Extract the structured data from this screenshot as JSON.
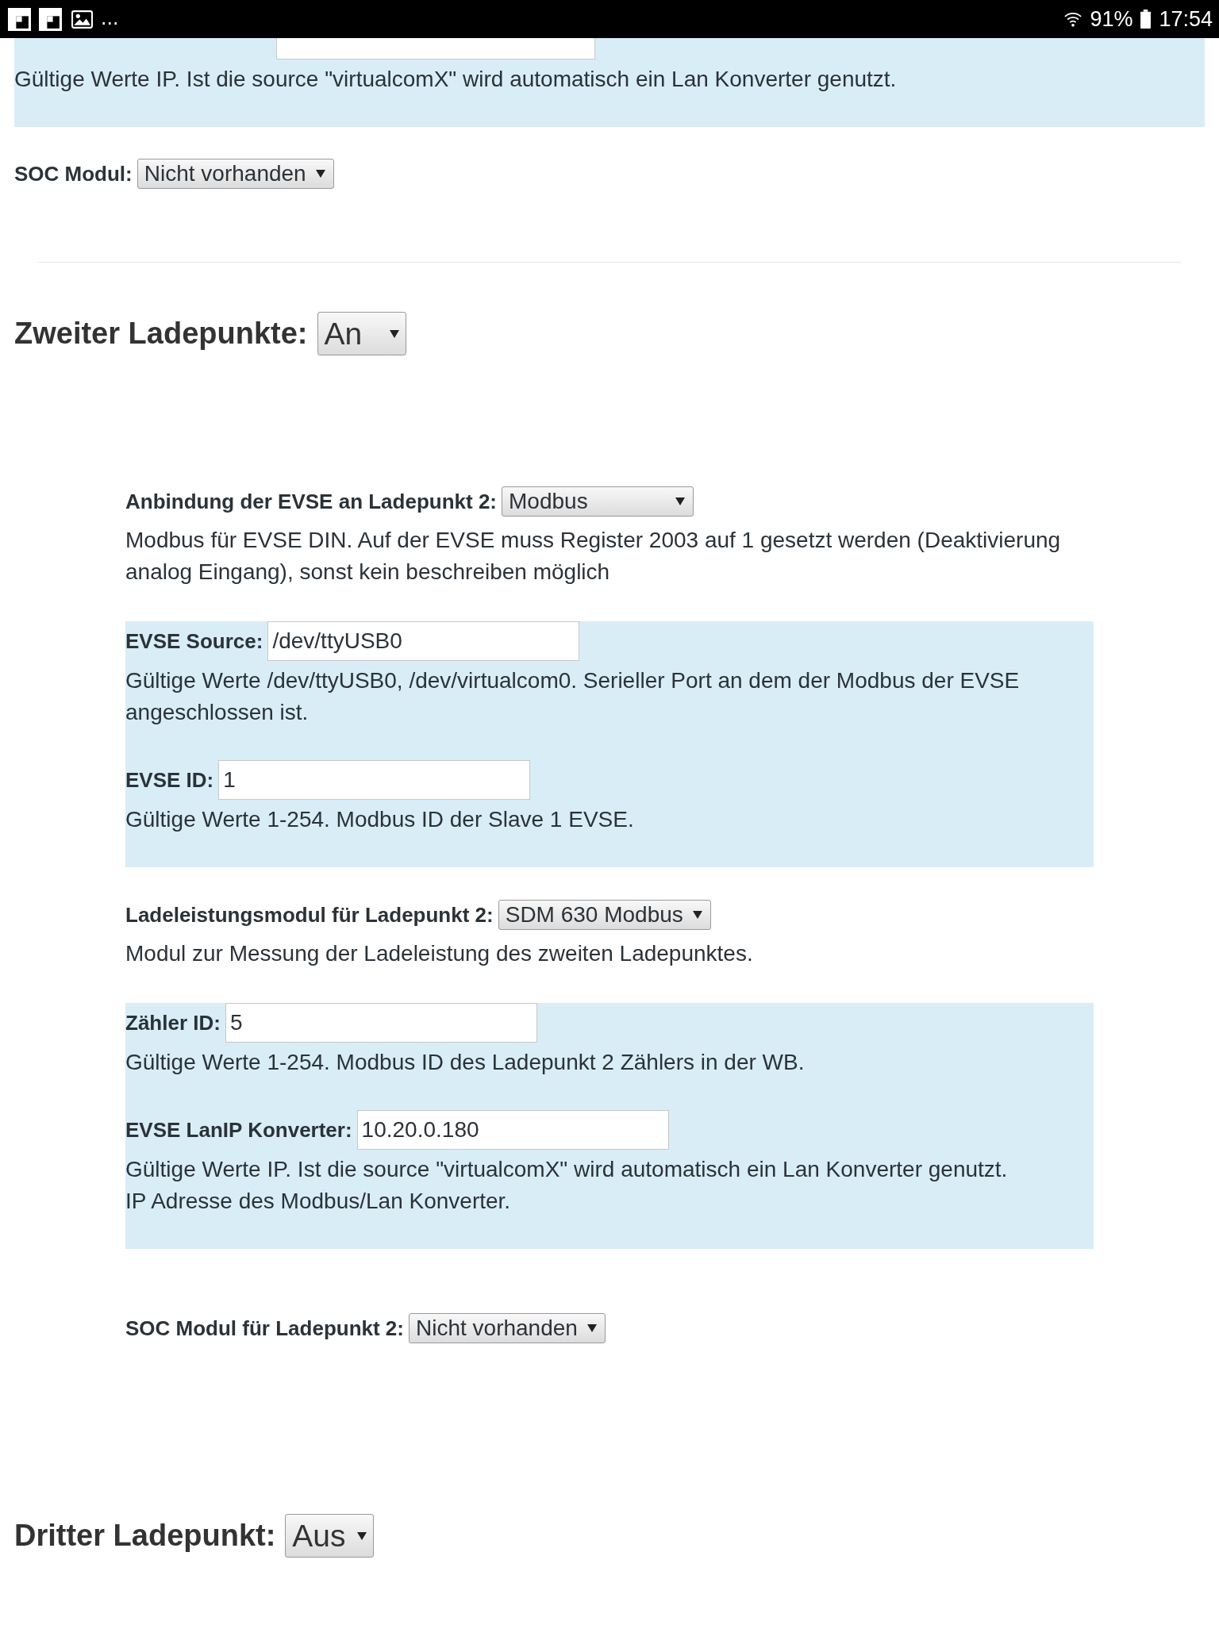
{
  "status_bar": {
    "more": "...",
    "battery": "91%",
    "time": "17:54"
  },
  "settings": [
    {
      "kind": "panel",
      "fields": [
        {
          "kind": "cut_off",
          "help": [
            "Gültige Werte IP. Ist die source \"virtualcomX\" wird automatisch ein Lan Konverter genutzt."
          ]
        }
      ]
    },
    {
      "kind": "select",
      "label": "SOC Modul:",
      "value": "Nicht vorhanden"
    },
    {
      "kind": "divider"
    },
    {
      "kind": "heading",
      "label": "Zweiter Ladepunkte:",
      "value": "An",
      "details": [
        {
          "kind": "select",
          "label": "Anbindung der EVSE an Ladepunkt 2:",
          "value": "Modbus",
          "help": [
            "Modbus für EVSE DIN. Auf der EVSE muss Register 2003 auf 1 gesetzt werden (Deaktivierung analog Eingang), sonst kein beschreiben möglich"
          ]
        },
        {
          "kind": "panel",
          "fields": [
            {
              "kind": "input",
              "label": "EVSE Source:",
              "value": "/dev/ttyUSB0",
              "help": [
                "Gültige Werte /dev/ttyUSB0, /dev/virtualcom0. Serieller Port an dem der Modbus der EVSE angeschlossen ist."
              ]
            },
            {
              "kind": "input",
              "label": "EVSE ID:",
              "value": "1",
              "help": [
                "Gültige Werte 1-254. Modbus ID der Slave 1 EVSE."
              ]
            }
          ]
        },
        {
          "kind": "select",
          "label": "Ladeleistungsmodul für Ladepunkt 2:",
          "value": "SDM 630 Modbus",
          "help": [
            "Modul zur Messung der Ladeleistung des zweiten Ladepunktes."
          ]
        },
        {
          "kind": "panel",
          "fields": [
            {
              "kind": "input",
              "label": "Zähler ID:",
              "value": "5",
              "help": [
                "Gültige Werte 1-254. Modbus ID des Ladepunkt 2 Zählers in der WB."
              ]
            },
            {
              "kind": "input",
              "label": "EVSE LanIP Konverter:",
              "value": "10.20.0.180",
              "help": [
                "Gültige Werte IP. Ist die source \"virtualcomX\" wird automatisch ein Lan Konverter genutzt.",
                "IP Adresse des Modbus/Lan Konverter."
              ]
            }
          ]
        },
        {
          "kind": "select",
          "label": "SOC Modul für Ladepunkt 2:",
          "value": "Nicht vorhanden"
        }
      ]
    },
    {
      "kind": "heading",
      "label": "Dritter Ladepunkt:",
      "value": "Aus"
    }
  ]
}
